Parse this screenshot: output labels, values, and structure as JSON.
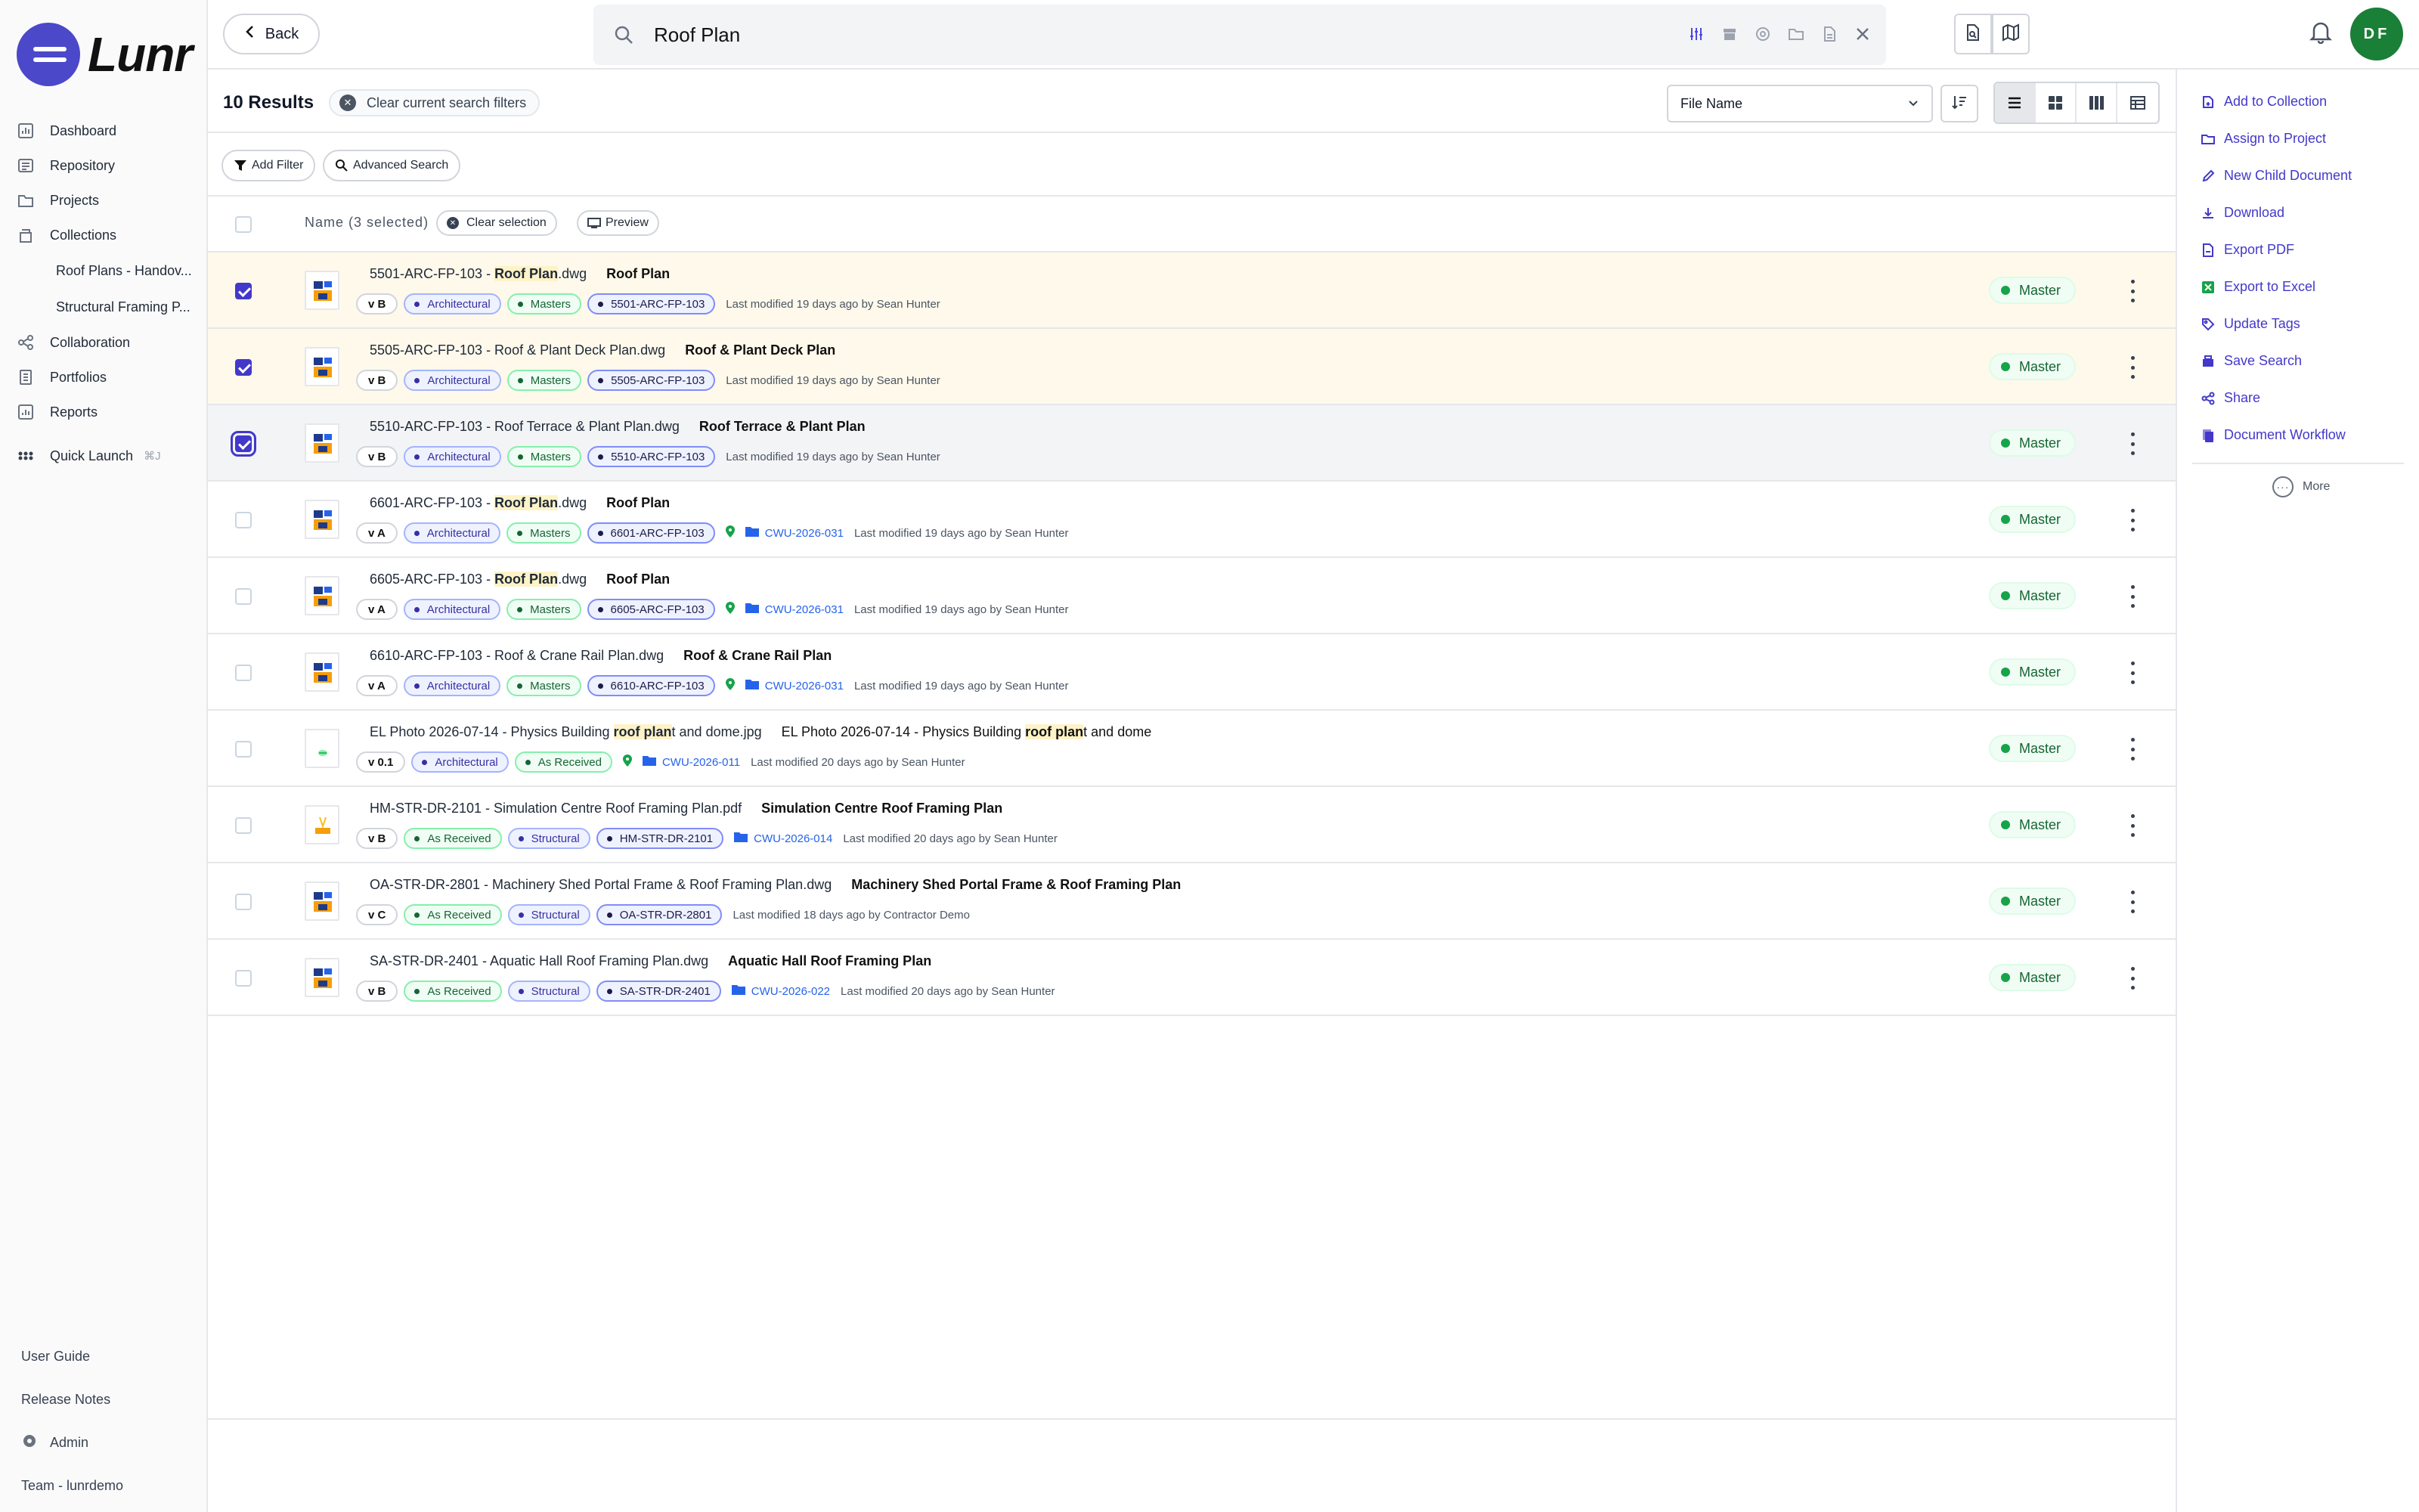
{
  "app": {
    "logo_text": "Lunr"
  },
  "sidebar": {
    "items": [
      {
        "label": "Dashboard"
      },
      {
        "label": "Repository"
      },
      {
        "label": "Projects"
      },
      {
        "label": "Collections"
      }
    ],
    "collections": [
      {
        "label": "Roof Plans - Handov..."
      },
      {
        "label": "Structural Framing P..."
      }
    ],
    "items2": [
      {
        "label": "Collaboration"
      },
      {
        "label": "Portfolios"
      },
      {
        "label": "Reports"
      }
    ],
    "quick_launch": {
      "label": "Quick Launch",
      "shortcut": "⌘J"
    },
    "bottom": [
      {
        "label": "User Guide"
      },
      {
        "label": "Release Notes"
      },
      {
        "label": "Admin"
      },
      {
        "label": "Team - lunrdemo"
      }
    ]
  },
  "topbar": {
    "back_label": "Back",
    "search_value": "Roof Plan",
    "avatar_initials": "DF"
  },
  "results": {
    "count_label": "10 Results",
    "clear_filters_label": "Clear current search filters",
    "sort_value": "File Name",
    "add_filter_label": "Add Filter",
    "advanced_search_label": "Advanced Search"
  },
  "table": {
    "name_header": "Name (3 selected)",
    "clear_selection_label": "Clear selection",
    "preview_label": "Preview",
    "rows": [
      {
        "pre": "5501-ARC-FP-103 - ",
        "hl": "Roof Plan",
        "post": ".dwg",
        "title": "Roof Plan",
        "ver": "v B",
        "tags": [
          {
            "t": "Architectural",
            "c": "purple"
          },
          {
            "t": "Masters",
            "c": "green"
          },
          {
            "t": "5501-ARC-FP-103",
            "c": "navy"
          }
        ],
        "project": "",
        "modified": "Last modified 19 days ago by Sean Hunter",
        "status": "Master",
        "checked": true,
        "state": "sel"
      },
      {
        "pre": "5505-ARC-FP-103 - Roof & Plant Deck Plan.dwg",
        "hl": "",
        "post": "",
        "title": "Roof & Plant Deck Plan",
        "ver": "v B",
        "tags": [
          {
            "t": "Architectural",
            "c": "purple"
          },
          {
            "t": "Masters",
            "c": "green"
          },
          {
            "t": "5505-ARC-FP-103",
            "c": "navy"
          }
        ],
        "project": "",
        "modified": "Last modified 19 days ago by Sean Hunter",
        "status": "Master",
        "checked": true,
        "state": "sel"
      },
      {
        "pre": "5510-ARC-FP-103 - Roof Terrace & Plant Plan.dwg",
        "hl": "",
        "post": "",
        "title": "Roof Terrace & Plant Plan",
        "ver": "v B",
        "tags": [
          {
            "t": "Architectural",
            "c": "purple"
          },
          {
            "t": "Masters",
            "c": "green"
          },
          {
            "t": "5510-ARC-FP-103",
            "c": "navy"
          }
        ],
        "project": "",
        "modified": "Last modified 19 days ago by Sean Hunter",
        "status": "Master",
        "checked": true,
        "state": "focused"
      },
      {
        "pre": "6601-ARC-FP-103 - ",
        "hl": "Roof Plan",
        "post": ".dwg",
        "title": "Roof Plan",
        "ver": "v A",
        "tags": [
          {
            "t": "Architectural",
            "c": "purple"
          },
          {
            "t": "Masters",
            "c": "green"
          },
          {
            "t": "6601-ARC-FP-103",
            "c": "navy"
          }
        ],
        "project": "CWU-2026-031",
        "modified": "Last modified 19 days ago by Sean Hunter",
        "status": "Master",
        "checked": false,
        "state": ""
      },
      {
        "pre": "6605-ARC-FP-103 - ",
        "hl": "Roof Plan",
        "post": ".dwg",
        "title": "Roof Plan",
        "ver": "v A",
        "tags": [
          {
            "t": "Architectural",
            "c": "purple"
          },
          {
            "t": "Masters",
            "c": "green"
          },
          {
            "t": "6605-ARC-FP-103",
            "c": "navy"
          }
        ],
        "project": "CWU-2026-031",
        "modified": "Last modified 19 days ago by Sean Hunter",
        "status": "Master",
        "checked": false,
        "state": ""
      },
      {
        "pre": "6610-ARC-FP-103 - Roof & Crane Rail Plan.dwg",
        "hl": "",
        "post": "",
        "title": "Roof & Crane Rail Plan",
        "ver": "v A",
        "tags": [
          {
            "t": "Architectural",
            "c": "purple"
          },
          {
            "t": "Masters",
            "c": "green"
          },
          {
            "t": "6610-ARC-FP-103",
            "c": "navy"
          }
        ],
        "project": "CWU-2026-031",
        "modified": "Last modified 19 days ago by Sean Hunter",
        "status": "Master",
        "checked": false,
        "state": ""
      },
      {
        "pre": "EL Photo 2026-07-14 - Physics Building ",
        "hl": "roof plan",
        "post": "t and dome.jpg",
        "title_pre": "EL Photo 2026-07-14 - Physics Building ",
        "title_hl": "roof plan",
        "title_post": "t and dome",
        "title": "",
        "ver": "v 0.1",
        "tags": [
          {
            "t": "Architectural",
            "c": "purple"
          },
          {
            "t": "As Received",
            "c": "green"
          }
        ],
        "project": "CWU-2026-011",
        "modified": "Last modified 20 days ago by Sean Hunter",
        "status": "Master",
        "checked": false,
        "state": "",
        "kind": "photo"
      },
      {
        "pre": "HM-STR-DR-2101 - Simulation Centre Roof Framing Plan.pdf",
        "hl": "",
        "post": "",
        "title": "Simulation Centre Roof Framing Plan",
        "ver": "v B",
        "tags": [
          {
            "t": "As Received",
            "c": "green"
          },
          {
            "t": "Structural",
            "c": "purple"
          },
          {
            "t": "HM-STR-DR-2101",
            "c": "navy"
          }
        ],
        "project": "CWU-2026-014",
        "modified": "Last modified 20 days ago by Sean Hunter",
        "status": "Master",
        "checked": false,
        "state": "",
        "kind": "pdf",
        "nopin": true
      },
      {
        "pre": "OA-STR-DR-2801 - Machinery Shed Portal Frame & Roof Framing Plan.dwg",
        "hl": "",
        "post": "",
        "title": "Machinery Shed Portal Frame & Roof Framing Plan",
        "ver": "v C",
        "tags": [
          {
            "t": "As Received",
            "c": "green"
          },
          {
            "t": "Structural",
            "c": "purple"
          },
          {
            "t": "OA-STR-DR-2801",
            "c": "navy"
          }
        ],
        "project": "",
        "modified": "Last modified 18 days ago by Contractor Demo",
        "status": "Master",
        "checked": false,
        "state": ""
      },
      {
        "pre": "SA-STR-DR-2401 - Aquatic Hall Roof Framing Plan.dwg",
        "hl": "",
        "post": "",
        "title": "Aquatic Hall Roof Framing Plan",
        "ver": "v B",
        "tags": [
          {
            "t": "As Received",
            "c": "green"
          },
          {
            "t": "Structural",
            "c": "purple"
          },
          {
            "t": "SA-STR-DR-2401",
            "c": "navy"
          }
        ],
        "project": "CWU-2026-022",
        "modified": "Last modified 20 days ago by Sean Hunter",
        "status": "Master",
        "checked": false,
        "state": "",
        "nopin": true
      }
    ]
  },
  "right_panel": {
    "actions": [
      {
        "label": "Add to Collection",
        "icon": "add-to-collection-icon"
      },
      {
        "label": "Assign to Project",
        "icon": "folder-icon"
      },
      {
        "label": "New Child Document",
        "icon": "pencil-icon"
      },
      {
        "label": "Download",
        "icon": "download-icon"
      },
      {
        "label": "Export PDF",
        "icon": "pdf-icon"
      },
      {
        "label": "Export to Excel",
        "icon": "excel-icon"
      },
      {
        "label": "Update Tags",
        "icon": "tag-icon"
      },
      {
        "label": "Save Search",
        "icon": "save-icon"
      },
      {
        "label": "Share",
        "icon": "share-icon"
      },
      {
        "label": "Document Workflow",
        "icon": "workflow-icon"
      }
    ],
    "more_label": "More"
  },
  "colors": {
    "accent": "#4338ca",
    "selected_row": "#fef9eb",
    "status_green": "#16a34a",
    "avatar": "#1a7f37"
  }
}
